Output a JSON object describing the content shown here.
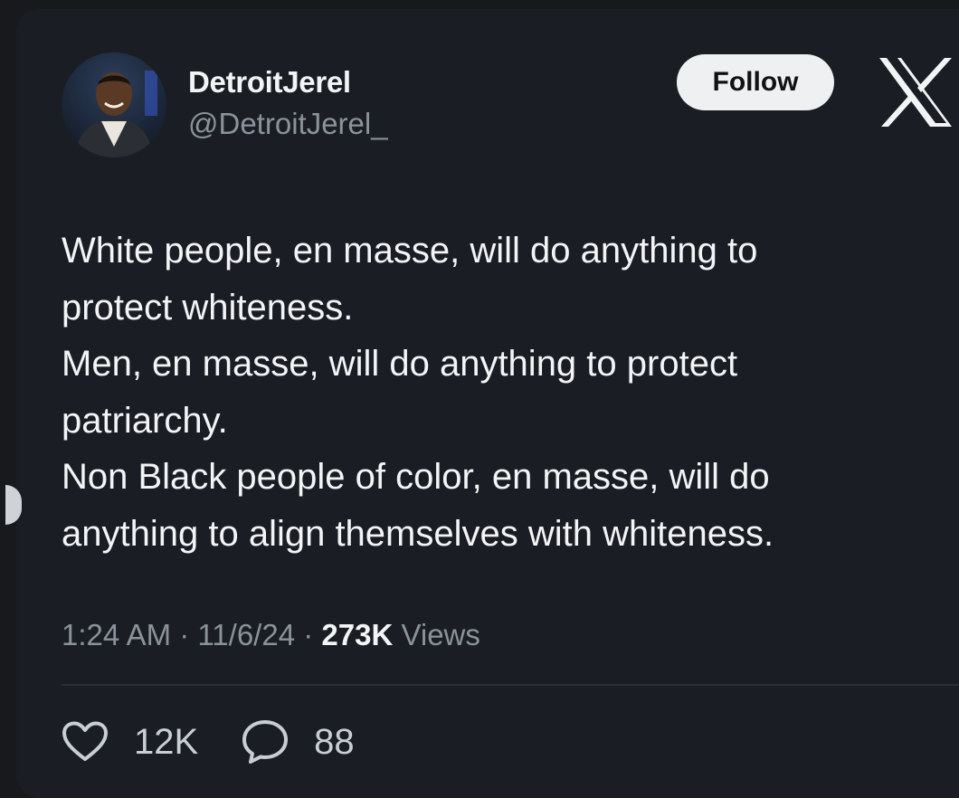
{
  "author": {
    "display_name": "DetroitJerel",
    "handle": "@DetroitJerel_"
  },
  "follow_label": "Follow",
  "platform_icon": "x-logo-icon",
  "tweet": {
    "lines": [
      "White people, en masse, will do anything to",
      "protect whiteness.",
      "Men, en masse, will do anything to protect",
      "patriarchy.",
      "Non Black people of color, en masse, will do",
      "anything to align themselves with whiteness."
    ]
  },
  "meta": {
    "time": "1:24 AM",
    "separator1": " · ",
    "date": "11/6/24",
    "separator2": " · ",
    "views_count": "273K",
    "views_label": " Views"
  },
  "actions": {
    "likes": "12K",
    "replies": "88"
  },
  "colors": {
    "background": "#1a1e24",
    "text_primary": "#f3f4f5",
    "text_secondary": "#8a929b",
    "follow_bg": "#eef0f2"
  }
}
